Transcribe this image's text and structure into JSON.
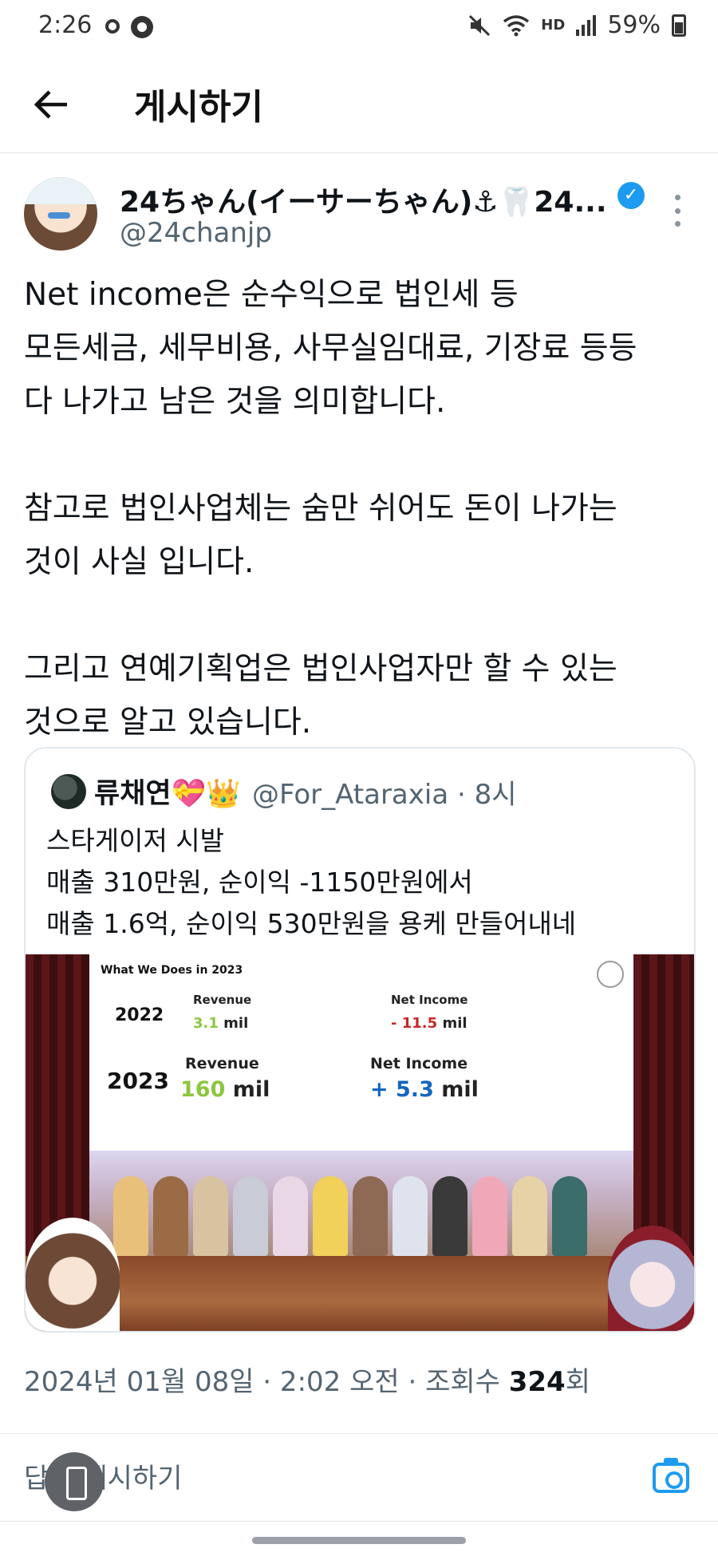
{
  "status_bar": {
    "time": "2:26",
    "battery": "59%",
    "net_label": "HD"
  },
  "header": {
    "title": "게시하기"
  },
  "author": {
    "name": "24ちゃん(イーサーちゃん)⚓🦷24...",
    "handle": "@24chanjp"
  },
  "tweet": {
    "text": "Net income은 순수익으로 법인세 등\n모든세금, 세무비용, 사무실임대료, 기장료 등등\n다 나가고 남은 것을 의미합니다.\n\n참고로 법인사업체는 숨만 쉬어도 돈이 나가는\n것이 사실 입니다.\n\n그리고 연예기획업은 법인사업자만 할 수 있는\n것으로 알고 있습니다."
  },
  "quoted": {
    "name": "류채연💝👑",
    "handle_time": "@For_Ataraxia · 8시",
    "text": "스타게이저 시발\n매출 310만원, 순이익 -1150만원에서\n매출 1.6억, 순이익 530만원을 용케 만들어내네",
    "slide": {
      "title": "What We Does in 2023",
      "year_2022": "2022",
      "year_2023": "2023",
      "revenue_label": "Revenue",
      "net_income_label": "Net Income",
      "revenue_2022_num": "3.1",
      "revenue_2022_unit": "mil",
      "net_income_2022_num": "- 11.5",
      "net_income_2022_unit": "mil",
      "revenue_2023_num": "160",
      "revenue_2023_unit": "mil",
      "net_income_2023_num": "+ 5.3",
      "net_income_2023_unit": "mil"
    }
  },
  "meta": {
    "datetime": "2024년 01월 08일 · 2:02 오전 · 조회수 ",
    "views": "324",
    "views_suffix": "회"
  },
  "reply": {
    "placeholder": "답글 게시하기"
  },
  "colors": {
    "accent": "#1d9bf0",
    "revenue_green": "#8cc63f",
    "loss_red": "#c62828",
    "profit_blue": "#1565c0"
  },
  "icons": [
    "back-arrow-icon",
    "verified-badge-icon",
    "more-options-icon",
    "camera-icon",
    "mute-icon",
    "wifi-icon",
    "signal-icon",
    "battery-icon"
  ]
}
